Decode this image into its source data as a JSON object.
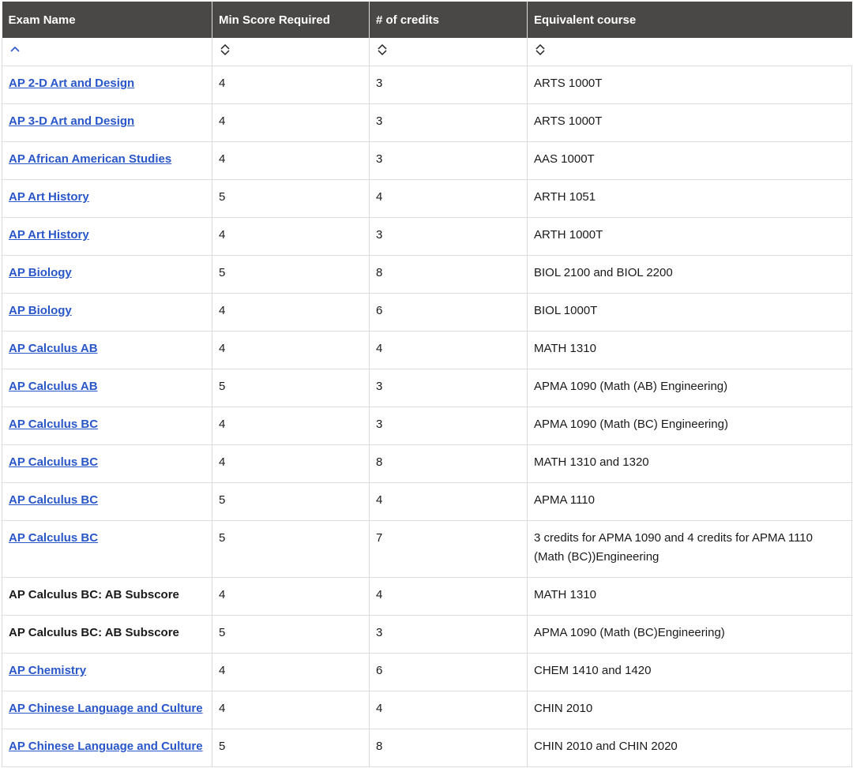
{
  "table": {
    "headers": [
      "Exam Name",
      "Min Score Required",
      "# of credits",
      "Equivalent course"
    ],
    "sort_icons": [
      "chevron-up-icon",
      "sort-toggle-icon",
      "sort-toggle-icon",
      "sort-toggle-icon"
    ],
    "accent_color": "#2956c9",
    "header_bg": "#4a4846",
    "rows": [
      {
        "exam": "AP 2-D Art and Design",
        "link": true,
        "score": "4",
        "credits": "3",
        "course": "ARTS 1000T"
      },
      {
        "exam": "AP 3-D Art and Design",
        "link": true,
        "score": "4",
        "credits": "3",
        "course": "ARTS 1000T"
      },
      {
        "exam": "AP African American Studies",
        "link": true,
        "score": "4",
        "credits": "3",
        "course": "AAS 1000T"
      },
      {
        "exam": "AP Art History",
        "link": true,
        "score": "5",
        "credits": "4",
        "course": "ARTH 1051"
      },
      {
        "exam": "AP Art History",
        "link": true,
        "score": "4",
        "credits": "3",
        "course": "ARTH 1000T"
      },
      {
        "exam": "AP Biology",
        "link": true,
        "score": "5",
        "credits": "8",
        "course": "BIOL 2100 and BIOL 2200"
      },
      {
        "exam": "AP Biology",
        "link": true,
        "score": "4",
        "credits": "6",
        "course": "BIOL 1000T"
      },
      {
        "exam": "AP Calculus AB",
        "link": true,
        "score": "4",
        "credits": "4",
        "course": "MATH 1310"
      },
      {
        "exam": "AP Calculus AB",
        "link": true,
        "score": "5",
        "credits": "3",
        "course": "APMA 1090 (Math (AB) Engineering)"
      },
      {
        "exam": "AP Calculus BC",
        "link": true,
        "score": "4",
        "credits": "3",
        "course": "APMA 1090 (Math (BC) Engineering)"
      },
      {
        "exam": "AP Calculus BC",
        "link": true,
        "score": "4",
        "credits": "8",
        "course": "MATH 1310 and 1320"
      },
      {
        "exam": "AP Calculus BC",
        "link": true,
        "score": "5",
        "credits": "4",
        "course": "APMA 1110"
      },
      {
        "exam": "AP Calculus BC",
        "link": true,
        "score": "5",
        "credits": "7",
        "course": "3 credits for APMA 1090 and 4 credits for APMA 1110 (Math (BC))Engineering"
      },
      {
        "exam": "AP Calculus BC: AB Subscore",
        "link": false,
        "score": "4",
        "credits": "4",
        "course": "MATH 1310"
      },
      {
        "exam": "AP Calculus BC: AB Subscore",
        "link": false,
        "score": "5",
        "credits": "3",
        "course": "APMA 1090 (Math (BC)Engineering)"
      },
      {
        "exam": "AP Chemistry",
        "link": true,
        "score": "4",
        "credits": "6",
        "course": "CHEM 1410 and 1420"
      },
      {
        "exam": "AP Chinese Language and Culture",
        "link": true,
        "score": "4",
        "credits": "4",
        "course": "CHIN 2010"
      },
      {
        "exam": "AP Chinese Language and Culture",
        "link": true,
        "score": "5",
        "credits": "8",
        "course": "CHIN 2010 and CHIN 2020"
      }
    ]
  }
}
